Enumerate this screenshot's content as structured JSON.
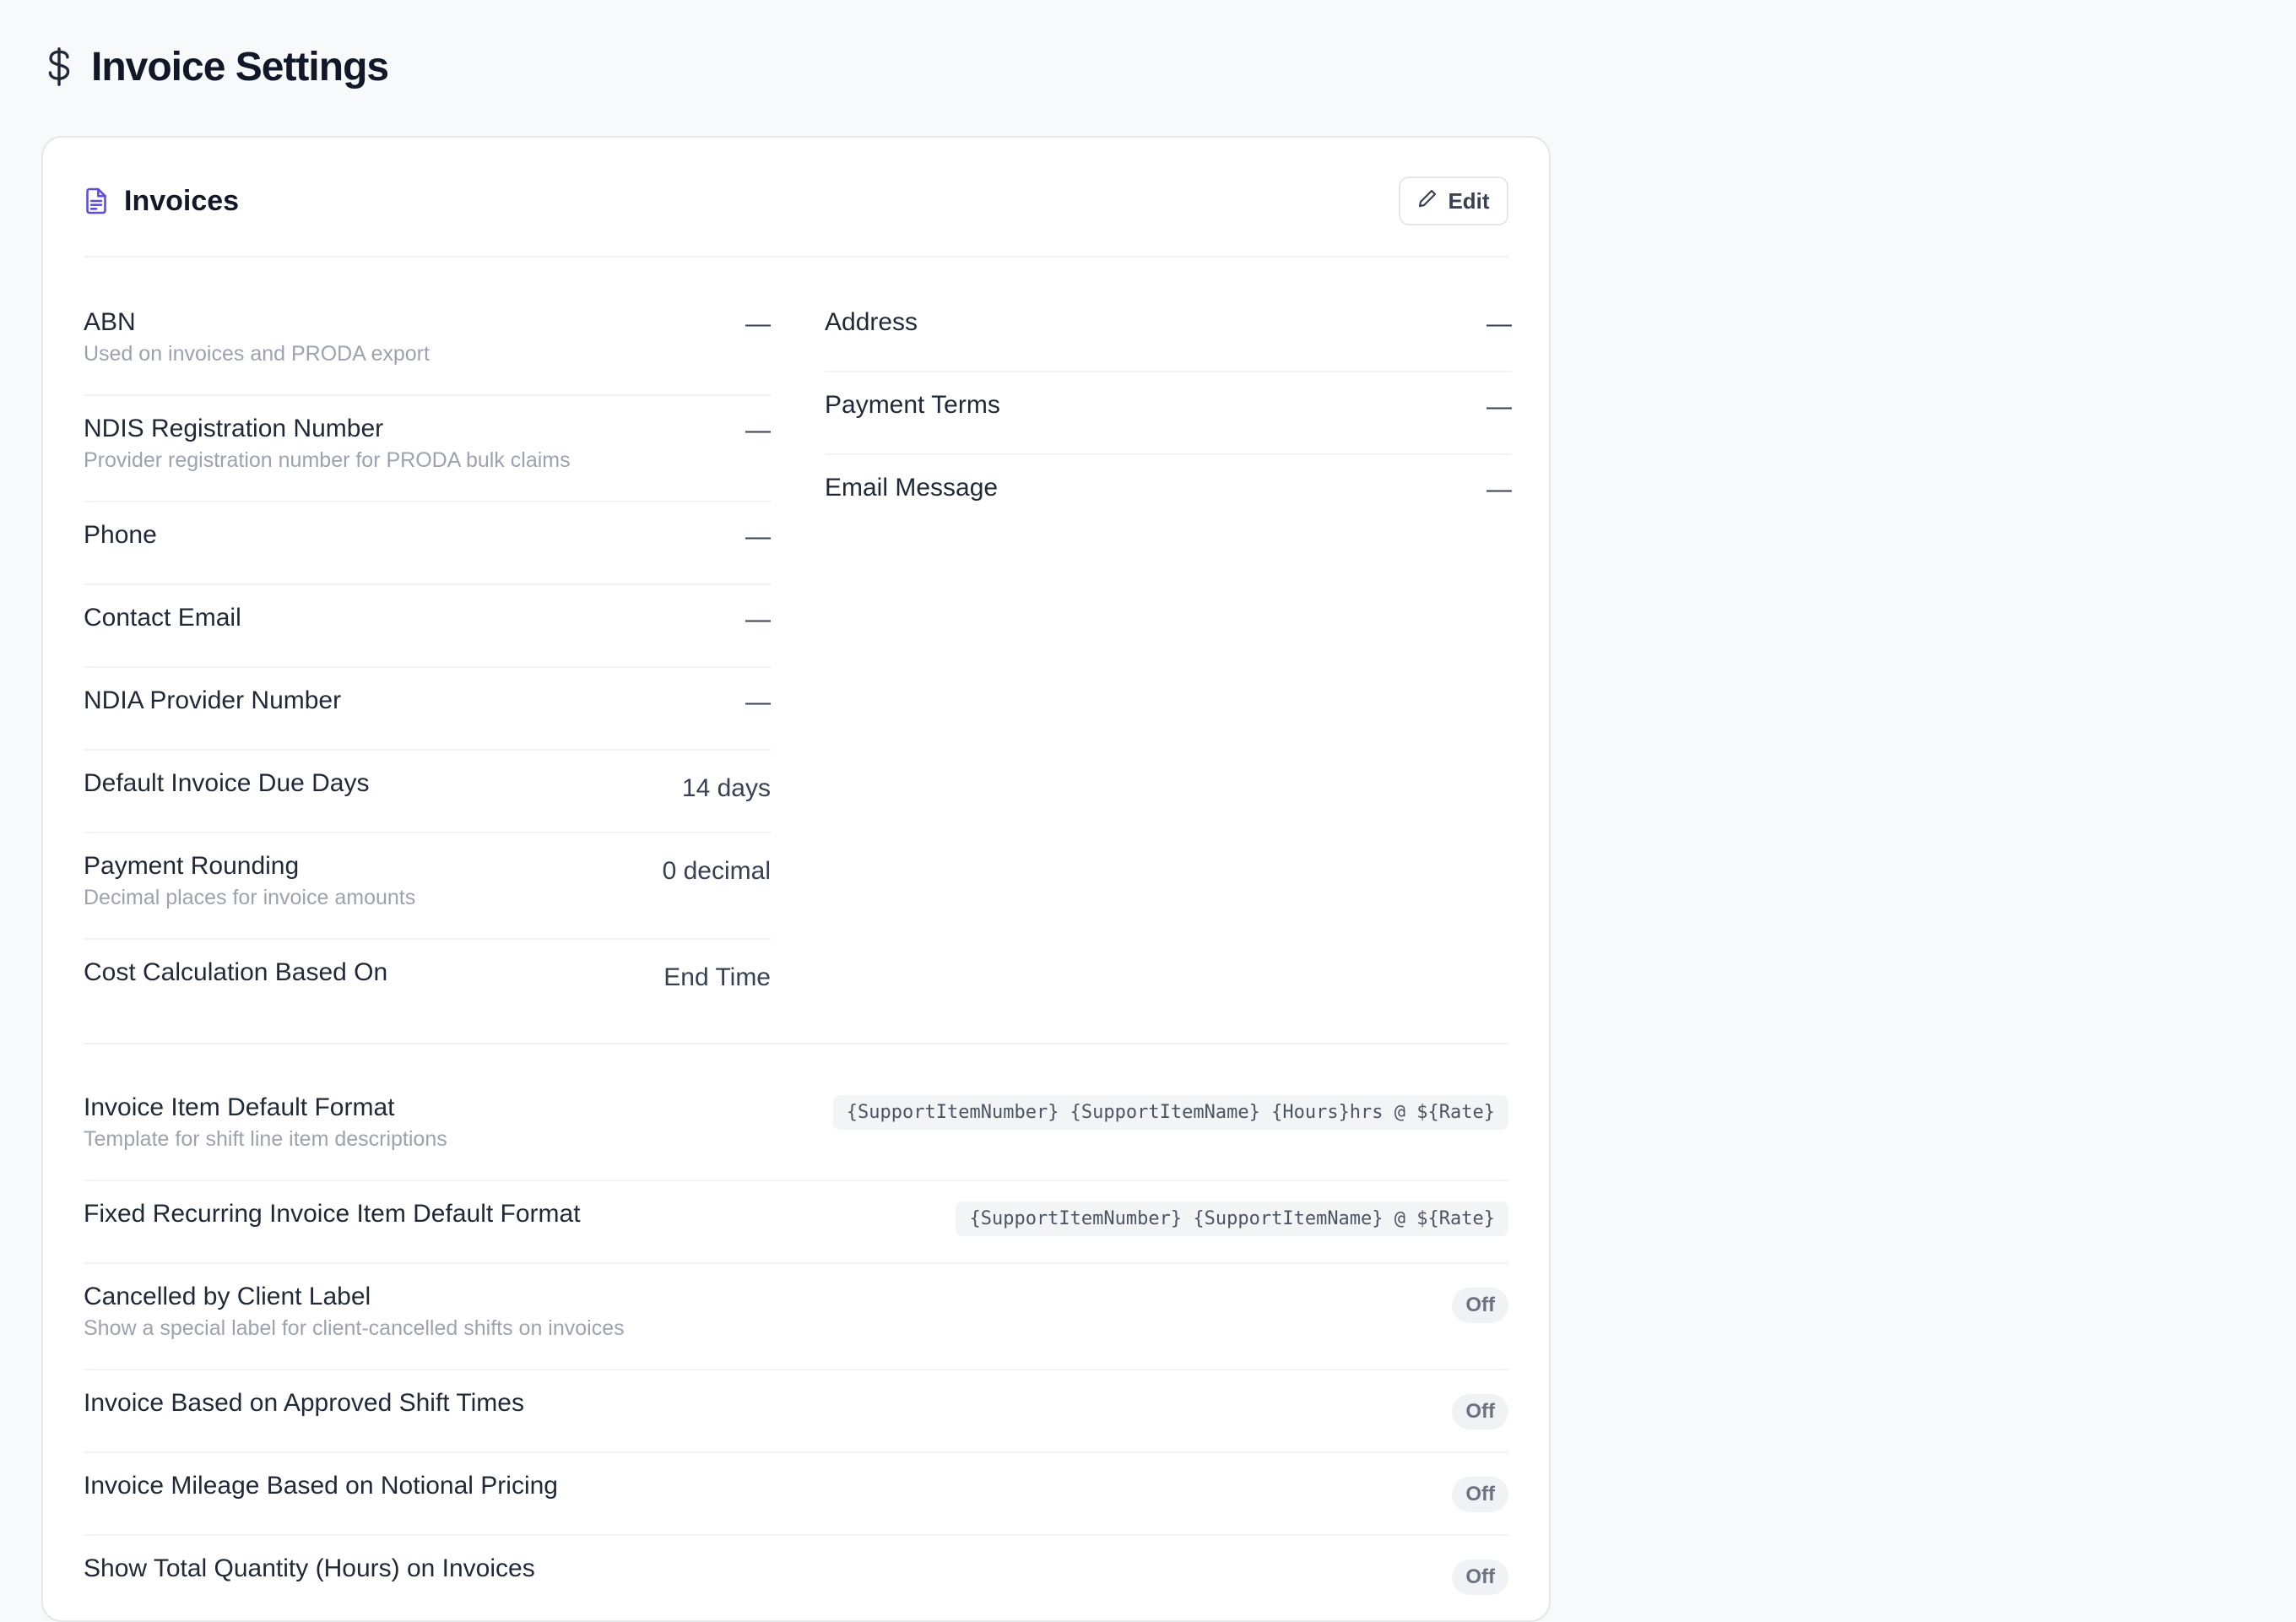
{
  "page": {
    "title": "Invoice Settings",
    "icon": "dollar-icon"
  },
  "card": {
    "title": "Invoices",
    "icon": "document-icon",
    "edit_label": "Edit"
  },
  "empty_value": "—",
  "left_fields": [
    {
      "label": "ABN",
      "desc": "Used on invoices and PRODA export",
      "value": "—"
    },
    {
      "label": "NDIS Registration Number",
      "desc": "Provider registration number for PRODA bulk claims",
      "value": "—"
    },
    {
      "label": "Phone",
      "value": "—"
    },
    {
      "label": "Contact Email",
      "value": "—"
    },
    {
      "label": "NDIA Provider Number",
      "value": "—"
    },
    {
      "label": "Default Invoice Due Days",
      "value": "14 days"
    },
    {
      "label": "Payment Rounding",
      "desc": "Decimal places for invoice amounts",
      "value": "0 decimal"
    },
    {
      "label": "Cost Calculation Based On",
      "value": "End Time"
    }
  ],
  "right_fields": [
    {
      "label": "Address",
      "value": "—"
    },
    {
      "label": "Payment Terms",
      "value": "—"
    },
    {
      "label": "Email Message",
      "value": "—"
    }
  ],
  "bottom_fields": [
    {
      "label": "Invoice Item Default Format",
      "desc": "Template for shift line item descriptions",
      "code": "{SupportItemNumber} {SupportItemName} {Hours}hrs @ ${Rate}"
    },
    {
      "label": "Fixed Recurring Invoice Item Default Format",
      "code": "{SupportItemNumber} {SupportItemName} @ ${Rate}"
    },
    {
      "label": "Cancelled by Client Label",
      "desc": "Show a special label for client-cancelled shifts on invoices",
      "toggle": "Off"
    },
    {
      "label": "Invoice Based on Approved Shift Times",
      "toggle": "Off"
    },
    {
      "label": "Invoice Mileage Based on Notional Pricing",
      "toggle": "Off"
    },
    {
      "label": "Show Total Quantity (Hours) on Invoices",
      "toggle": "Off"
    }
  ]
}
